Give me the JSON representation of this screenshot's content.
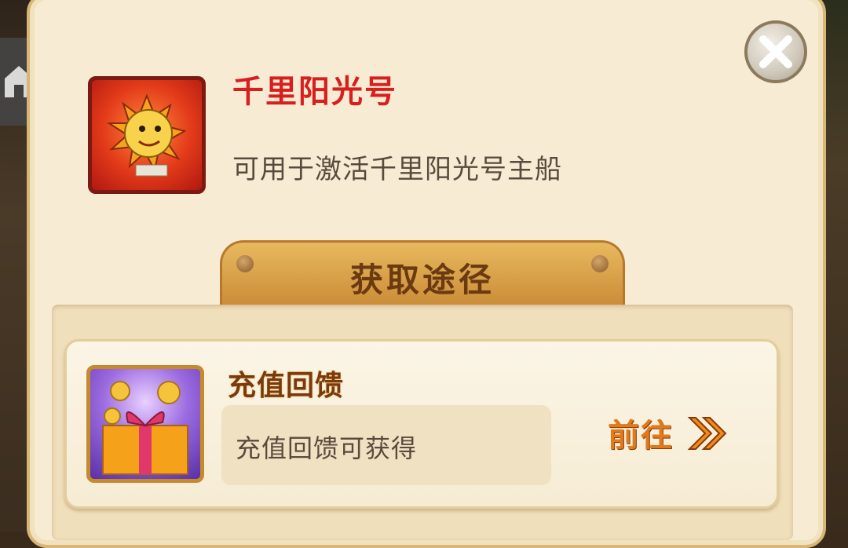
{
  "item": {
    "name": "千里阳光号",
    "description": "可用于激活千里阳光号主船",
    "icon": "thousand-sunny-ship-icon"
  },
  "acquire_tab": {
    "title": "获取途径"
  },
  "sources": [
    {
      "title": "充值回馈",
      "description": "充值回馈可获得",
      "button_label": "前往",
      "icon": "gift-box-coins-icon"
    }
  ],
  "colors": {
    "item_name": "#d81e1e",
    "button_text": "#e07a1a",
    "panel_bg": "#f7ecd3"
  }
}
